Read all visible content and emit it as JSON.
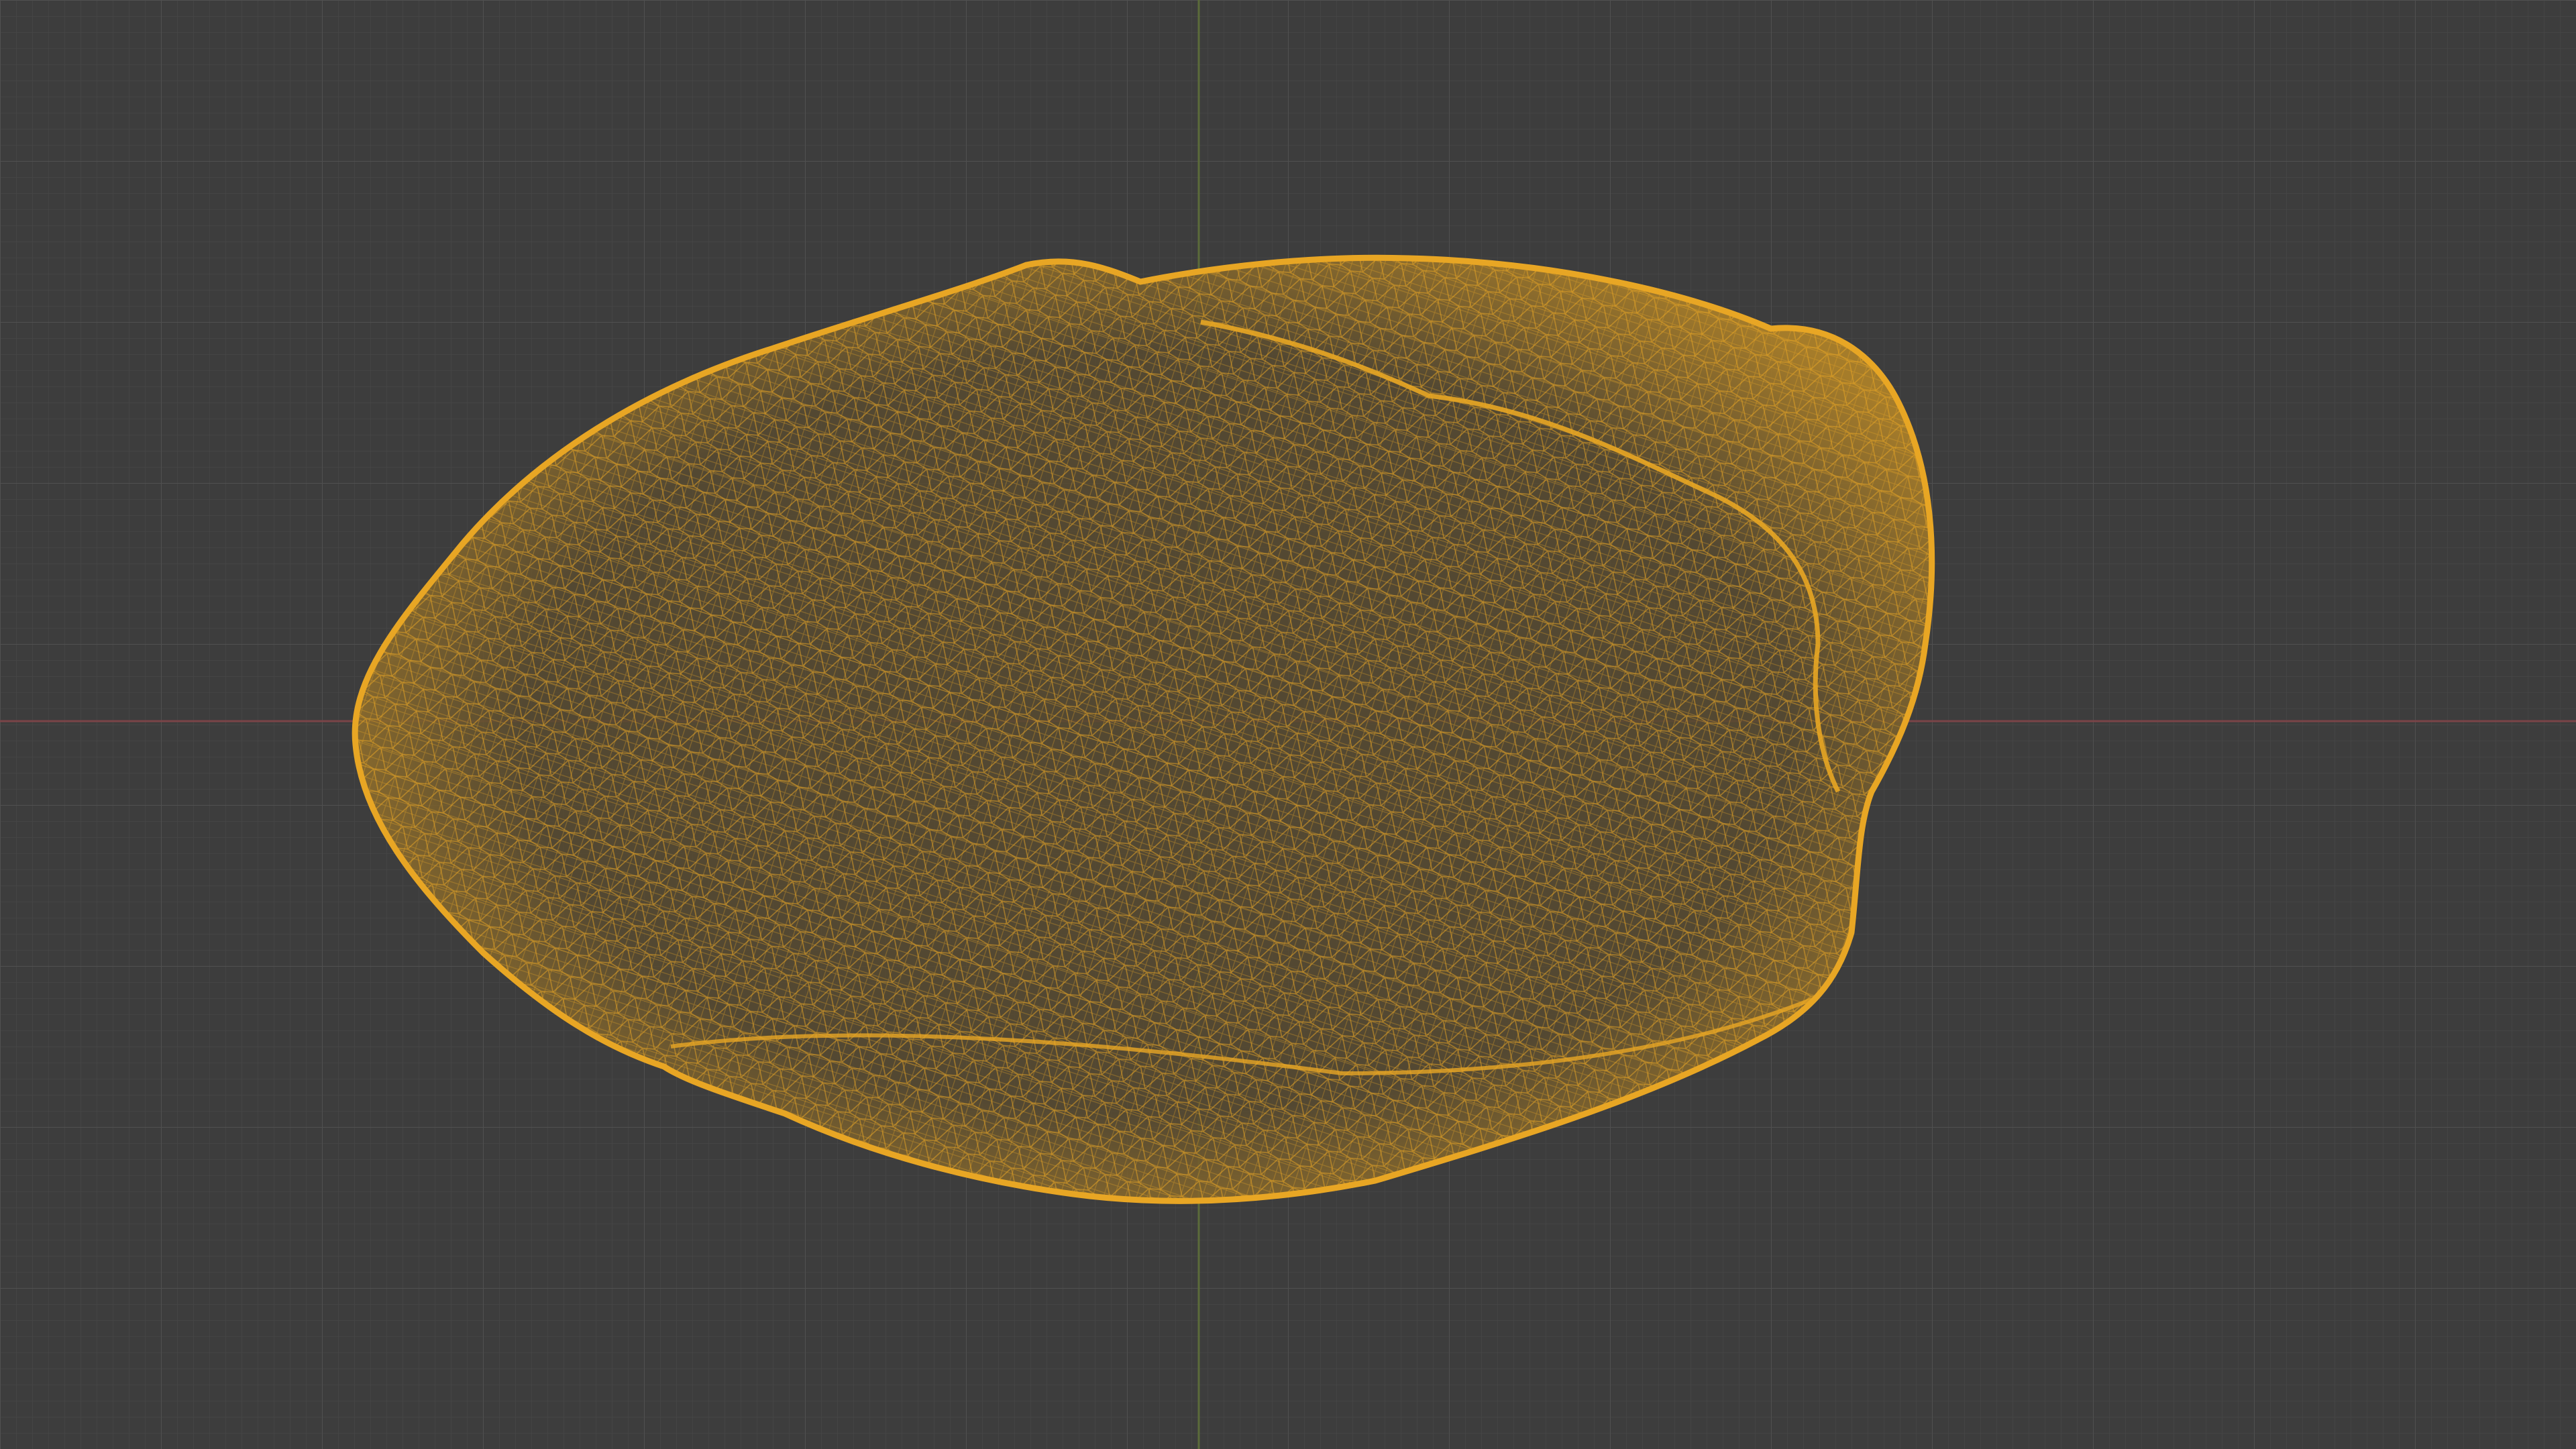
{
  "viewport": {
    "view_mode": "wireframe",
    "selected_object": "mesh-object",
    "colors": {
      "background": "#3d3d3d",
      "grid_minor": "#474747",
      "grid_major": "#505050",
      "axis_x": "#7a4448",
      "axis_y": "#5b6b3a",
      "wire_selected": "#e8a624",
      "wire_fill": "#574a30"
    }
  }
}
